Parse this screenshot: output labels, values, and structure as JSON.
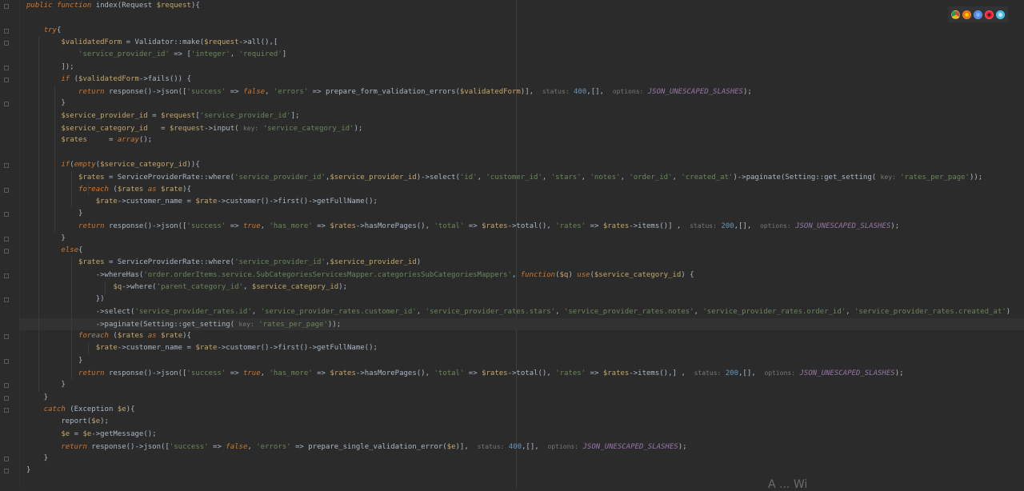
{
  "lines": [
    {
      "t": "public function index(Request $request){"
    },
    {
      "t": ""
    },
    {
      "t": "    try{"
    },
    {
      "t": "        $validatedForm = Validator::make($request->all(),["
    },
    {
      "t": "            'service_provider_id' => ['integer', 'required']"
    },
    {
      "t": "        ]);"
    },
    {
      "t": "        if ($validatedForm->fails()) {"
    },
    {
      "t": "            return response()->json(['success' => false, 'errors' => prepare_form_validation_errors($validatedForm)],  status: 400,[],  options: JSON_UNESCAPED_SLASHES);"
    },
    {
      "t": "        }"
    },
    {
      "t": "        $service_provider_id = $request['service_provider_id'];"
    },
    {
      "t": "        $service_category_id   = $request->input( key: 'service_category_id');"
    },
    {
      "t": "        $rates     = array();"
    },
    {
      "t": ""
    },
    {
      "t": "        if(empty($service_category_id)){"
    },
    {
      "t": "            $rates = ServiceProviderRate::where('service_provider_id',$service_provider_id)->select('id', 'customer_id', 'stars', 'notes', 'order_id', 'created_at')->paginate(Setting::get_setting( key: 'rates_per_page'));"
    },
    {
      "t": "            foreach ($rates as $rate){"
    },
    {
      "t": "                $rate->customer_name = $rate->customer()->first()->getFullName();"
    },
    {
      "t": "            }"
    },
    {
      "t": "            return response()->json(['success' => true, 'has_more' => $rates->hasMorePages(), 'total' => $rates->total(), 'rates' => $rates->items()] ,  status: 200,[],  options: JSON_UNESCAPED_SLASHES);"
    },
    {
      "t": "        }"
    },
    {
      "t": "        else{"
    },
    {
      "t": "            $rates = ServiceProviderRate::where('service_provider_id',$service_provider_id)"
    },
    {
      "t": "                ->whereHas('order.orderItems.service.SubCategoriesServicesMapper.categoriesSubCategoriesMappers', function($q) use($service_category_id) {"
    },
    {
      "t": "                    $q->where('parent_category_id', $service_category_id);"
    },
    {
      "t": "                })"
    },
    {
      "t": "                ->select('service_provider_rates.id', 'service_provider_rates.customer_id', 'service_provider_rates.stars', 'service_provider_rates.notes', 'service_provider_rates.order_id', 'service_provider_rates.created_at')"
    },
    {
      "t": "                ->paginate(Setting::get_setting( key: 'rates_per_page'));"
    },
    {
      "t": "            foreach ($rates as $rate){"
    },
    {
      "t": "                $rate->customer_name = $rate->customer()->first()->getFullName();"
    },
    {
      "t": "            }"
    },
    {
      "t": "            return response()->json(['success' => true, 'has_more' => $rates->hasMorePages(), 'total' => $rates->total(), 'rates' => $rates->items(),] ,  status: 200,[],  options: JSON_UNESCAPED_SLASHES);"
    },
    {
      "t": "        }"
    },
    {
      "t": "    }"
    },
    {
      "t": "    catch (Exception $e){"
    },
    {
      "t": "        report($e);"
    },
    {
      "t": "        $e = $e->getMessage();"
    },
    {
      "t": "        return response()->json(['success' => false, 'errors' => prepare_single_validation_error($e)],  status: 400,[],  options: JSON_UNESCAPED_SLASHES);"
    },
    {
      "t": "    }"
    },
    {
      "t": "}"
    }
  ],
  "current_line": 26,
  "browser_icons": [
    "chrome-icon",
    "firefox-icon",
    "chromium-icon",
    "opera-icon",
    "ie-icon"
  ],
  "watermark": "A   ...   Wi"
}
